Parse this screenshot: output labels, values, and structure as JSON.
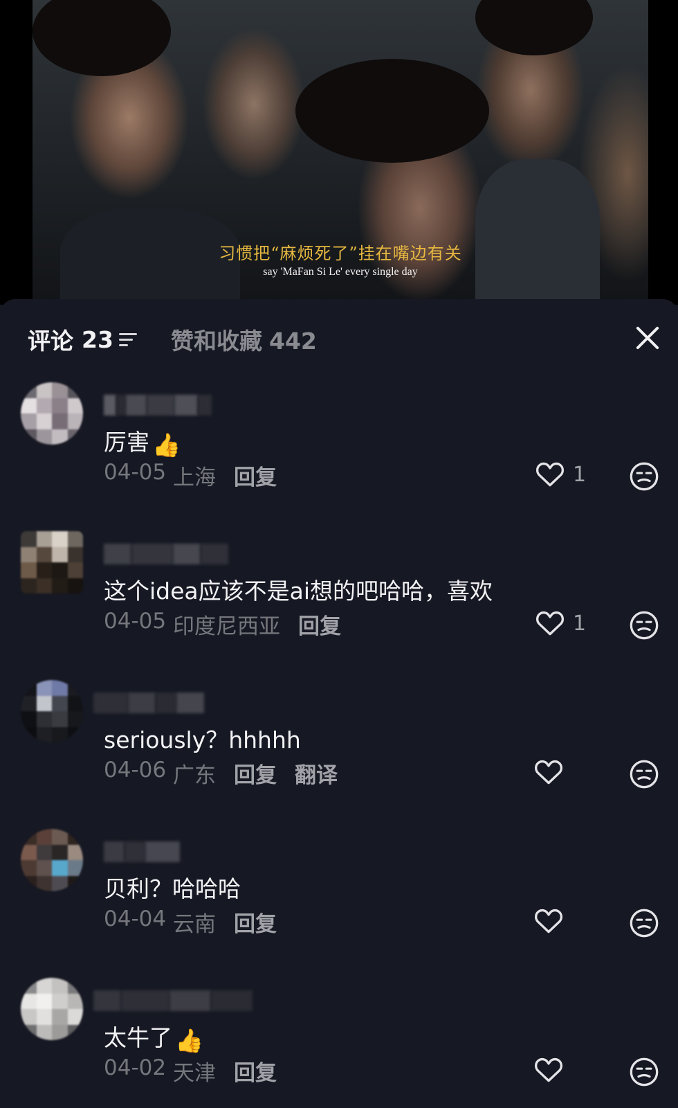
{
  "video": {
    "subtitle_cn": "习惯把“麻烦死了”挂在嘴边有关",
    "subtitle_en": "say 'MaFan Si Le' every single day"
  },
  "tabs": {
    "comments_label": "评论",
    "comments_count": "23",
    "likes_label": "赞和收藏",
    "likes_count": "442"
  },
  "icons": {
    "sort": "sort-lines-icon",
    "close": "close-x-icon",
    "like": "heart-outline-icon",
    "dislike": "unamused-face-icon",
    "thumb": "thumbs-up-emoji"
  },
  "colors": {
    "panel_bg": "#161823",
    "subtitle_cn": "#e6b840",
    "meta_text": "#76777d"
  },
  "comments": [
    {
      "text": "厉害",
      "emoji": "👍",
      "date": "04-05",
      "location": "上海",
      "reply": "回复",
      "translate": "",
      "likes": "1"
    },
    {
      "text": "这个idea应该不是ai想的吧哈哈，喜欢",
      "emoji": "",
      "date": "04-05",
      "location": "印度尼西亚",
      "reply": "回复",
      "translate": "",
      "likes": "1"
    },
    {
      "text": "seriously？hhhhh",
      "emoji": "",
      "date": "04-06",
      "location": "广东",
      "reply": "回复",
      "translate": "翻译",
      "likes": ""
    },
    {
      "text": "贝利？哈哈哈",
      "emoji": "",
      "date": "04-04",
      "location": "云南",
      "reply": "回复",
      "translate": "",
      "likes": ""
    },
    {
      "text": "太牛了",
      "emoji": "👍",
      "date": "04-02",
      "location": "天津",
      "reply": "回复",
      "translate": "",
      "likes": ""
    }
  ]
}
